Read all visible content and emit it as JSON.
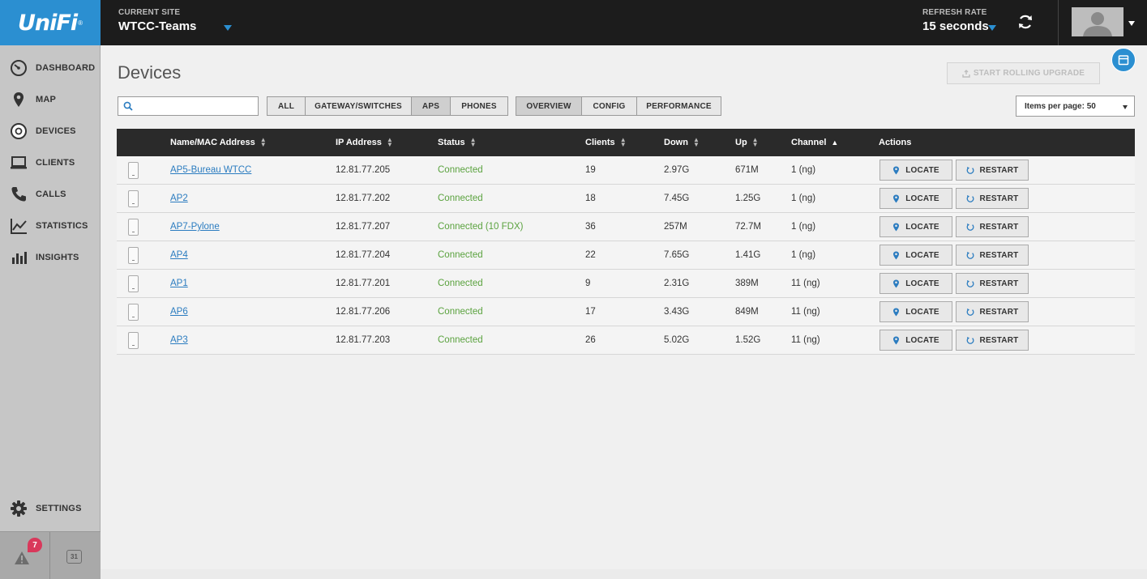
{
  "brand": {
    "logo_text": "UniFi",
    "logo_mark": "®"
  },
  "header": {
    "site_label": "CURRENT SITE",
    "site_name": "WTCC-Teams",
    "refresh_label": "REFRESH RATE",
    "refresh_value": "15 seconds"
  },
  "sidebar": {
    "items": [
      {
        "label": "DASHBOARD",
        "icon": "dashboard-icon"
      },
      {
        "label": "MAP",
        "icon": "map-pin-icon"
      },
      {
        "label": "DEVICES",
        "icon": "devices-icon"
      },
      {
        "label": "CLIENTS",
        "icon": "laptop-icon"
      },
      {
        "label": "CALLS",
        "icon": "phone-icon"
      },
      {
        "label": "STATISTICS",
        "icon": "line-chart-icon"
      },
      {
        "label": "INSIGHTS",
        "icon": "bar-chart-icon"
      }
    ],
    "settings_label": "SETTINGS",
    "alerts_count": "7",
    "calendar_day": "31"
  },
  "main": {
    "title": "Devices",
    "rolling_upgrade_label": "START ROLLING UPGRADE",
    "search_placeholder": "",
    "filters": [
      "ALL",
      "GATEWAY/SWITCHES",
      "APS",
      "PHONES"
    ],
    "active_filter": "APS",
    "views": [
      "OVERVIEW",
      "CONFIG",
      "PERFORMANCE"
    ],
    "active_view": "OVERVIEW",
    "items_per_page_label": "Items per page: 50"
  },
  "table": {
    "columns": [
      "Name/MAC Address",
      "IP Address",
      "Status",
      "Clients",
      "Down",
      "Up",
      "Channel",
      "Actions"
    ],
    "sort_column": "Channel",
    "sort_direction": "ascending",
    "locate_label": "LOCATE",
    "restart_label": "RESTART",
    "rows": [
      {
        "name": "AP5-Bureau WTCC",
        "ip": "12.81.77.205",
        "status": "Connected",
        "clients": "19",
        "down": "2.97G",
        "up": "671M",
        "channel": "1 (ng)"
      },
      {
        "name": "AP2",
        "ip": "12.81.77.202",
        "status": "Connected",
        "clients": "18",
        "down": "7.45G",
        "up": "1.25G",
        "channel": "1 (ng)"
      },
      {
        "name": "AP7-Pylone",
        "ip": "12.81.77.207",
        "status": "Connected (10 FDX)",
        "clients": "36",
        "down": "257M",
        "up": "72.7M",
        "channel": "1 (ng)"
      },
      {
        "name": "AP4",
        "ip": "12.81.77.204",
        "status": "Connected",
        "clients": "22",
        "down": "7.65G",
        "up": "1.41G",
        "channel": "1 (ng)"
      },
      {
        "name": "AP1",
        "ip": "12.81.77.201",
        "status": "Connected",
        "clients": "9",
        "down": "2.31G",
        "up": "389M",
        "channel": "11 (ng)"
      },
      {
        "name": "AP6",
        "ip": "12.81.77.206",
        "status": "Connected",
        "clients": "17",
        "down": "3.43G",
        "up": "849M",
        "channel": "11 (ng)"
      },
      {
        "name": "AP3",
        "ip": "12.81.77.203",
        "status": "Connected",
        "clients": "26",
        "down": "5.02G",
        "up": "1.52G",
        "channel": "11 (ng)"
      }
    ]
  },
  "colors": {
    "accent": "#2b8fd1",
    "status_ok": "#5aa23e",
    "badge": "#d9385b",
    "topbar": "#1c1c1c"
  }
}
